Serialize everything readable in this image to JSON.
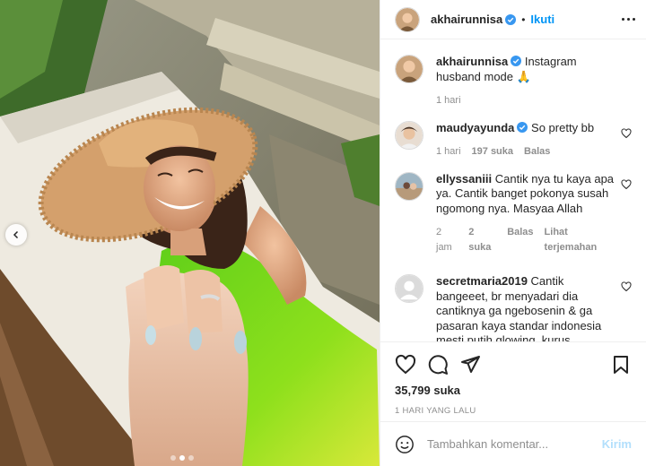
{
  "post": {
    "username": "akhairunnisa",
    "follow_label": "Ikuti",
    "separator": "•",
    "caption": {
      "username": "akhairunnisa",
      "text": "Instagram husband mode 🙏",
      "time": "1 hari"
    },
    "comments": [
      {
        "username": "maudyayunda",
        "verified": true,
        "text": "So pretty bb",
        "time": "1 hari",
        "likes": "197 suka",
        "reply": "Balas",
        "translate": ""
      },
      {
        "username": "ellyssaniii",
        "verified": false,
        "text": "Cantik nya tu kaya apa ya. Cantik banget pokonya susah ngomong nya. Masyaa Allah",
        "time": "2 jam",
        "likes": "2 suka",
        "reply": "Balas",
        "translate": "Lihat terjemahan"
      },
      {
        "username": "secretmaria2019",
        "verified": false,
        "text": "Cantik bangeeet, br menyadari dia cantiknya ga ngebosenin & ga pasaran kaya standar indonesia mesti putih glowing, kurus langsing, ini lebih",
        "time": "",
        "likes": "",
        "reply": "",
        "translate": ""
      }
    ],
    "like_count": "35,799 suka",
    "time_ago": "1 HARI YANG LALU",
    "add_comment": {
      "placeholder": "Tambahkan komentar...",
      "post_label": "Kirim"
    },
    "carousel": {
      "total": 3,
      "active": 2
    },
    "colors": {
      "accent": "#0095f6",
      "verified": "#3897f0",
      "post_disabled": "#b2dffc"
    }
  }
}
